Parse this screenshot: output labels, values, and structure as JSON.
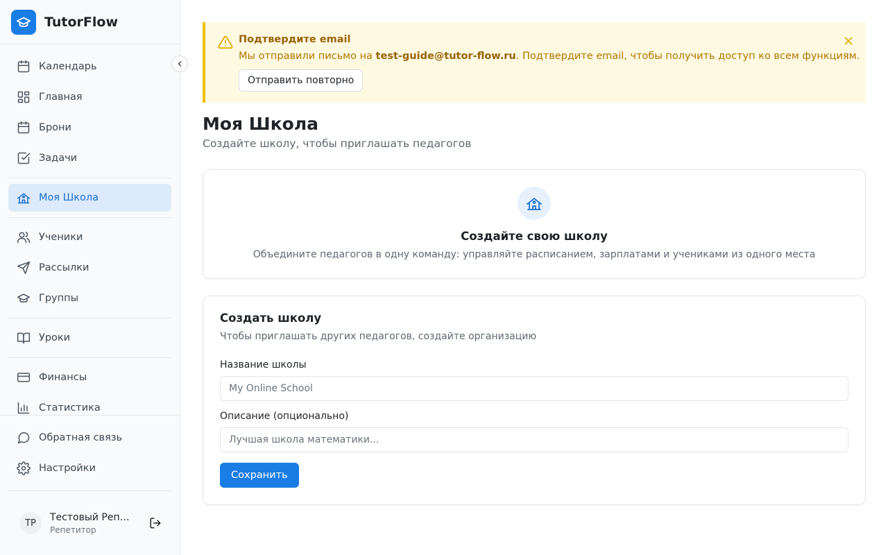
{
  "app": {
    "name": "TutorFlow",
    "logo_icon": "graduation-cap-icon",
    "accent_color": "#1a7de6"
  },
  "sidebar": {
    "items": [
      {
        "label": "Календарь",
        "icon": "calendar-icon"
      },
      {
        "label": "Главная",
        "icon": "dashboard-icon"
      },
      {
        "label": "Брони",
        "icon": "calendar-icon"
      },
      {
        "label": "Задачи",
        "icon": "checkbox-icon"
      },
      {
        "label": "Моя Школа",
        "icon": "school-icon",
        "active": true
      },
      {
        "label": "Ученики",
        "icon": "users-icon"
      },
      {
        "label": "Рассылки",
        "icon": "send-icon"
      },
      {
        "label": "Группы",
        "icon": "graduation-cap-icon"
      },
      {
        "label": "Уроки",
        "icon": "book-icon"
      },
      {
        "label": "Финансы",
        "icon": "credit-card-icon"
      },
      {
        "label": "Статистика",
        "icon": "bar-chart-icon"
      },
      {
        "label": "Обратная связь",
        "icon": "message-icon"
      },
      {
        "label": "Настройки",
        "icon": "gear-icon"
      }
    ],
    "user": {
      "initials": "ТР",
      "name": "Тестовый Репетитор",
      "role": "Репетитор"
    }
  },
  "alert": {
    "title": "Подтвердите email",
    "text_before": "Мы отправили письмо на ",
    "email": "test-guide@tutor-flow.ru",
    "text_after": ". Подтвердите email, чтобы получить доступ ко всем функциям.",
    "button": "Отправить повторно",
    "color": "#f0c000"
  },
  "page": {
    "title": "Моя Школа",
    "subtitle": "Создайте школу, чтобы приглашать педагогов"
  },
  "hero_card": {
    "title": "Создайте свою школу",
    "text": "Объедините педагогов в одну команду: управляйте расписанием, зарплатами и учениками из одного места"
  },
  "form": {
    "title": "Создать школу",
    "subtitle": "Чтобы приглашать других педагогов, создайте организацию",
    "name_label": "Название школы",
    "name_placeholder": "My Online School",
    "description_label": "Описание (опционально)",
    "description_placeholder": "Лучшая школа математики...",
    "save_label": "Сохранить"
  }
}
